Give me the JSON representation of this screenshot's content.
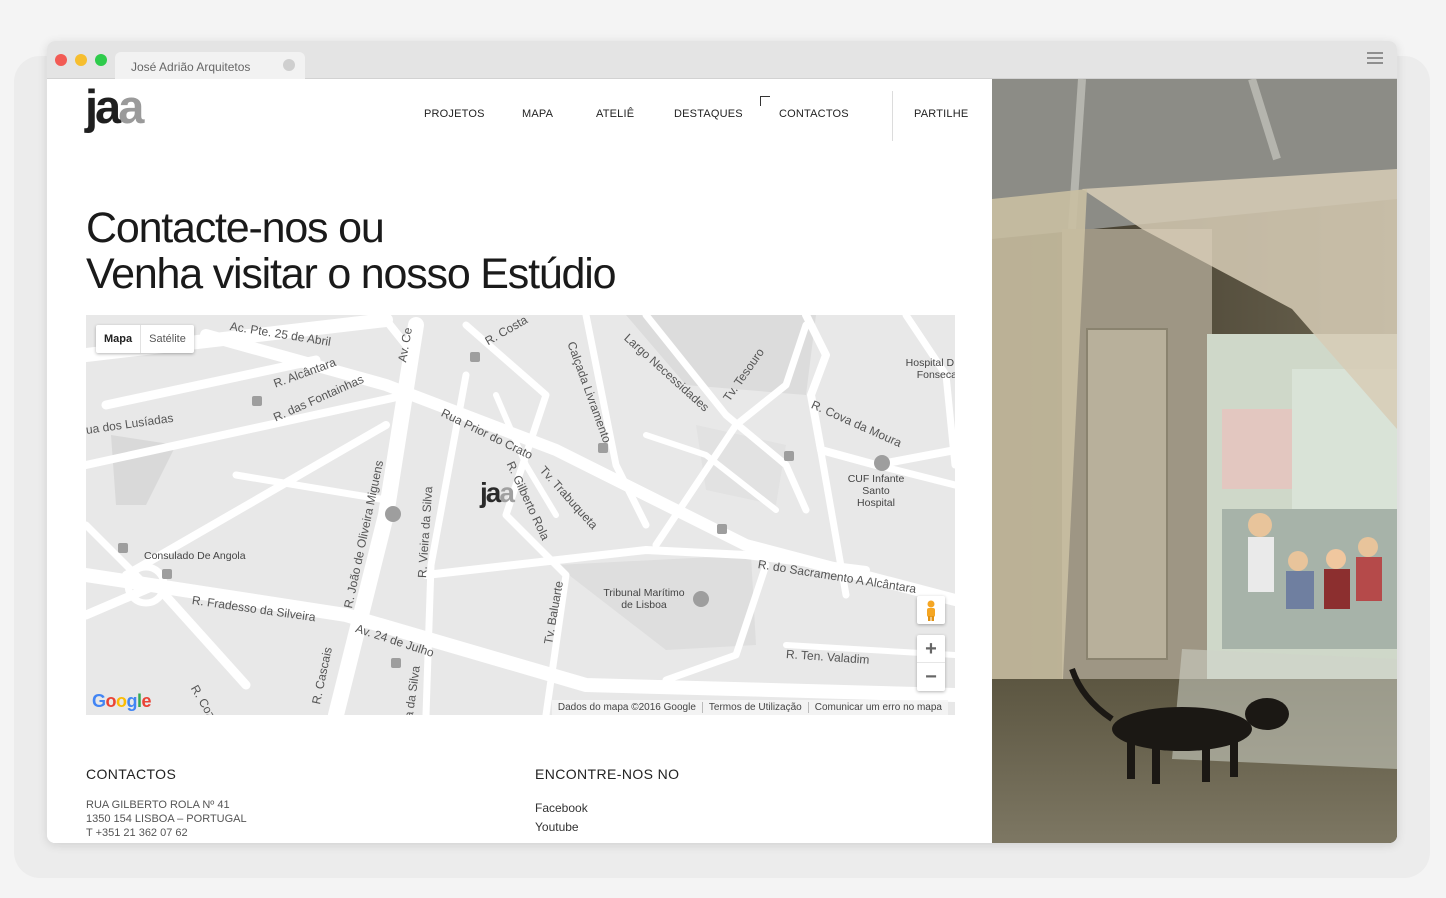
{
  "browser": {
    "tab_title": "José Adrião Arquitetos"
  },
  "header": {
    "logo_ja": "ja",
    "logo_a": "a",
    "nav": [
      {
        "label": "PROJETOS"
      },
      {
        "label": "MAPA"
      },
      {
        "label": "ATELIÊ"
      },
      {
        "label": "DESTAQUES"
      },
      {
        "label": "CONTACTOS"
      }
    ],
    "share_label": "PARTILHE"
  },
  "heading": {
    "line1": "Contacte-nos ou",
    "line2": "Venha visitar o nosso Estúdio"
  },
  "map": {
    "type_map": "Mapa",
    "type_satellite": "Satélite",
    "labels": {
      "ac_pte": "Ac. Pte. 25 de Abril",
      "r_costa": "R. Costa",
      "calcada_livramento": "Calçada Livramento",
      "largo_necessidades": "Largo Necessidades",
      "tv_tesouro": "Tv. Tesouro",
      "hospital_d_fonseca": "Hospital D. Fonseca",
      "av_ce": "Av. Ce",
      "r_alcantara": "R. Alcântara",
      "r_fontainhas": "R. das Fontainhas",
      "ua_lusiadas": "ua dos Lusíadas",
      "rua_prior_crato": "Rua Prior do Crato",
      "r_cova_moura": "R. Cova da Moura",
      "cuf": "CUF Infante Santo Hospital",
      "r_joao_oliveira": "R. João de Oliveira Miguens",
      "r_vieira_silva": "R. Vieira da Silva",
      "r_gilberto_rola": "R. Gilberto Rola",
      "tv_trabuqueta": "Tv. Trabuqueta",
      "consulado": "Consulado De Angola",
      "r_fradesso": "R. Fradesso da Silveira",
      "tribunal": "Tribunal Marítimo de Lisboa",
      "tv_baluarte": "Tv. Baluarte",
      "r_sacramento": "R. do Sacramento A Alcântara",
      "av_24_julho": "Av. 24 de Julho",
      "r_ten_valadim": "R. Ten. Valadim",
      "r_cascais": "R. Cascais",
      "r_cozinha": "R. Cozin",
      "da_silva": "ra da Silva"
    },
    "logo_ja": "ja",
    "logo_a": "a",
    "zoom_in": "+",
    "zoom_out": "−",
    "attribution": "Dados do mapa ©2016 Google",
    "terms": "Termos de Utilização",
    "report": "Comunicar um erro no mapa",
    "google_letters": [
      "G",
      "o",
      "o",
      "g",
      "l",
      "e"
    ]
  },
  "contacts": {
    "title": "CONTACTOS",
    "address_line1": "RUA GILBERTO ROLA Nº 41",
    "address_line2": "1350 154 LISBOA – PORTUGAL",
    "phone": "T +351 21 362 07 62"
  },
  "social": {
    "title": "ENCONTRE-NOS NO",
    "links": [
      {
        "label": "Facebook"
      },
      {
        "label": "Youtube"
      }
    ]
  },
  "colors": {
    "logo_dark": "#1f1f1f",
    "logo_grey": "#9a9a9a",
    "map_bg": "#e8e8e8",
    "road": "#ffffff",
    "block": "#dedede"
  }
}
